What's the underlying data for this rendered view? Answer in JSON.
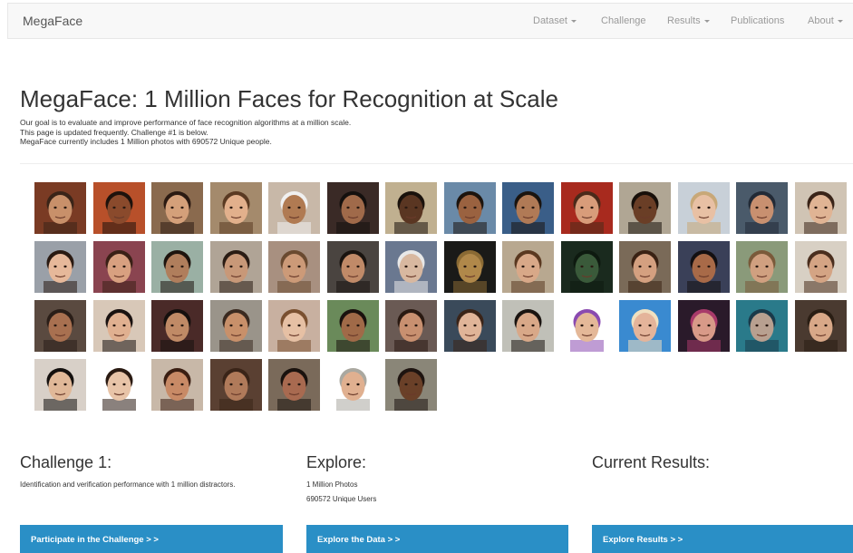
{
  "navbar": {
    "brand": "MegaFace",
    "items": [
      {
        "label": "Dataset",
        "dropdown": true
      },
      {
        "label": "Challenge",
        "dropdown": false
      },
      {
        "label": "Results",
        "dropdown": true
      },
      {
        "label": "Publications",
        "dropdown": false
      },
      {
        "label": "About",
        "dropdown": true
      }
    ]
  },
  "header": {
    "title": "MegaFace: 1 Million Faces for Recognition at Scale",
    "lines": [
      "Our goal is to evaluate and improve performance of face recognition algorithms at a million scale.",
      "This page is updated frequently. Challenge #1 is below.",
      "MegaFace currently includes 1 Million photos with 690572 Unique people."
    ]
  },
  "gallery": {
    "faces": [
      {
        "bg": "#7a3b24",
        "skin": "#c8906a",
        "hair": "#3a2418"
      },
      {
        "bg": "#b8502a",
        "skin": "#8a4a2c",
        "hair": "#1e120c"
      },
      {
        "bg": "#8a6a4e",
        "skin": "#d4a07a",
        "hair": "#2b1a12"
      },
      {
        "bg": "#a48a6c",
        "skin": "#e2b08c",
        "hair": "#5a3a22"
      },
      {
        "bg": "#c8b8a8",
        "skin": "#b07a52",
        "hair": "#f0f0f0"
      },
      {
        "bg": "#3a2a26",
        "skin": "#a06a4a",
        "hair": "#14100e"
      },
      {
        "bg": "#c0b090",
        "skin": "#5a3622",
        "hair": "#1a120c"
      },
      {
        "bg": "#6a8aa8",
        "skin": "#9a6240",
        "hair": "#1c140e"
      },
      {
        "bg": "#3a5e88",
        "skin": "#b07a56",
        "hair": "#1a1410"
      },
      {
        "bg": "#a82a1e",
        "skin": "#d89c7a",
        "hair": "#4a2a1a"
      },
      {
        "bg": "#b0a694",
        "skin": "#6a3e26",
        "hair": "#18100a"
      },
      {
        "bg": "#c8d0d8",
        "skin": "#e8c0a4",
        "hair": "#c8a878"
      },
      {
        "bg": "#4a5a6a",
        "skin": "#c89070",
        "hair": "#222a36"
      },
      {
        "bg": "#d0c4b4",
        "skin": "#e0b494",
        "hair": "#3a2418"
      },
      {
        "bg": "#9aa0a8",
        "skin": "#e6b89a",
        "hair": "#2a1a12"
      },
      {
        "bg": "#8a4450",
        "skin": "#d8a080",
        "hair": "#3a2016"
      },
      {
        "bg": "#9ab0a4",
        "skin": "#b07e5c",
        "hair": "#1e140e"
      },
      {
        "bg": "#b0a496",
        "skin": "#c89878",
        "hair": "#2a1c14"
      },
      {
        "bg": "#a89080",
        "skin": "#cc9a78",
        "hair": "#6a4a30"
      },
      {
        "bg": "#4a4440",
        "skin": "#c08a68",
        "hair": "#1a1410"
      },
      {
        "bg": "#6a7890",
        "skin": "#d8b8a0",
        "hair": "#e8e8e8"
      },
      {
        "bg": "#1a1a18",
        "skin": "#b0884a",
        "hair": "#8a6a34"
      },
      {
        "bg": "#b8a890",
        "skin": "#d8a888",
        "hair": "#5a3820"
      },
      {
        "bg": "#1a2a1e",
        "skin": "#3a5a3a",
        "hair": "#0e1a10"
      },
      {
        "bg": "#7a6a58",
        "skin": "#d4a080",
        "hair": "#3a2214"
      },
      {
        "bg": "#3a4058",
        "skin": "#a86a48",
        "hair": "#141012"
      },
      {
        "bg": "#8a9a7a",
        "skin": "#d0a080",
        "hair": "#7a5a3a"
      },
      {
        "bg": "#d8d0c4",
        "skin": "#d4a484",
        "hair": "#4a2e1e"
      },
      {
        "bg": "#5a4a40",
        "skin": "#a87050",
        "hair": "#2a1e18"
      },
      {
        "bg": "#d8c8b8",
        "skin": "#e0b090",
        "hair": "#1a1210"
      },
      {
        "bg": "#4a2a28",
        "skin": "#c08a66",
        "hair": "#16100e"
      },
      {
        "bg": "#9a948a",
        "skin": "#c8906a",
        "hair": "#3a2a20"
      },
      {
        "bg": "#c8b0a0",
        "skin": "#e6c0a4",
        "hair": "#7a5030"
      },
      {
        "bg": "#6a8a5a",
        "skin": "#a06a48",
        "hair": "#1a120e"
      },
      {
        "bg": "#6a5a54",
        "skin": "#c89070",
        "hair": "#2a1a12"
      },
      {
        "bg": "#3a4a5a",
        "skin": "#e0b498",
        "hair": "#3a2418"
      },
      {
        "bg": "#c0c0b8",
        "skin": "#d8a888",
        "hair": "#1a1410"
      },
      {
        "bg": "#ffffff",
        "skin": "#e4b898",
        "hair": "#8a4ab0"
      },
      {
        "bg": "#3a8ad0",
        "skin": "#e4b49a",
        "hair": "#f0e0c0"
      },
      {
        "bg": "#2a1a2a",
        "skin": "#d89a88",
        "hair": "#a83a6a"
      },
      {
        "bg": "#2a7a8a",
        "skin": "#b8a090",
        "hair": "#1a3a4a"
      },
      {
        "bg": "#4a3a30",
        "skin": "#d8a888",
        "hair": "#2a1e14"
      },
      {
        "bg": "#d8d0c8",
        "skin": "#e0b898",
        "hair": "#14100e"
      },
      {
        "bg": "#ffffff",
        "skin": "#e8c4a8",
        "hair": "#2a1a12"
      },
      {
        "bg": "#c8b8a8",
        "skin": "#c88a66",
        "hair": "#3a1e12"
      },
      {
        "bg": "#5a4032",
        "skin": "#b07a5a",
        "hair": "#3a2418"
      },
      {
        "bg": "#7a6a5a",
        "skin": "#a86a50",
        "hair": "#1a120e"
      },
      {
        "bg": "#ffffff",
        "skin": "#e0b090",
        "hair": "#aaa8a0"
      },
      {
        "bg": "#8a8678",
        "skin": "#6a4028",
        "hair": "#1e1410"
      }
    ]
  },
  "sections": {
    "challenge": {
      "title": "Challenge 1:",
      "desc": "Identification and verification performance with 1 million distractors.",
      "button": "Participate in the Challenge > >"
    },
    "explore": {
      "title": "Explore:",
      "line1": "1 Million Photos",
      "line2": "690572 Unique Users",
      "button": "Explore the Data > >"
    },
    "results": {
      "title": "Current Results:",
      "button": "Explore Results > >"
    }
  },
  "colors": {
    "button_bg": "#2a8fc6",
    "navbar_bg": "#f8f8f8"
  }
}
